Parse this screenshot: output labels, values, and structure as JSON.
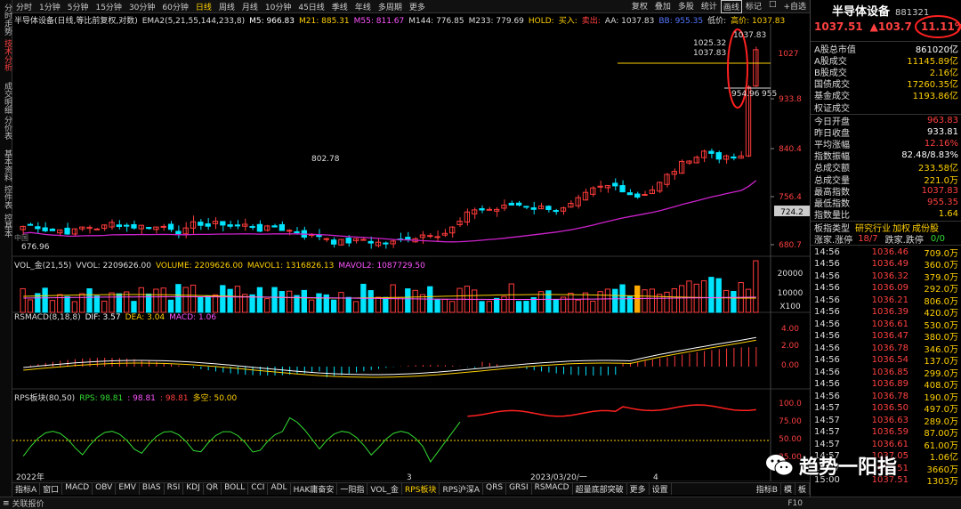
{
  "left_tabs": [
    {
      "label": "分时走势",
      "active": false
    },
    {
      "label": "技术分析",
      "active": true
    },
    {
      "label": "成交明细",
      "active": false
    },
    {
      "label": "分价表",
      "active": false
    },
    {
      "label": "基本资料",
      "active": false
    },
    {
      "label": "控件表",
      "active": false
    },
    {
      "label": "控基本",
      "active": false
    }
  ],
  "toolbar": {
    "periods": [
      {
        "label": "分时",
        "active": false
      },
      {
        "label": "1分钟",
        "active": false
      },
      {
        "label": "5分钟",
        "active": false
      },
      {
        "label": "15分钟",
        "active": false
      },
      {
        "label": "30分钟",
        "active": false
      },
      {
        "label": "60分钟",
        "active": false
      },
      {
        "label": "日线",
        "active": true
      },
      {
        "label": "周线",
        "active": false
      },
      {
        "label": "月线",
        "active": false
      },
      {
        "label": "10分钟",
        "active": false
      },
      {
        "label": "45日线",
        "active": false
      },
      {
        "label": "季线",
        "active": false
      },
      {
        "label": "年线",
        "active": false
      },
      {
        "label": "多周期",
        "active": false
      },
      {
        "label": "更多",
        "active": false
      }
    ],
    "tools": [
      {
        "label": "复权",
        "boxed": false
      },
      {
        "label": "叠加",
        "boxed": false
      },
      {
        "label": "多股",
        "boxed": false
      },
      {
        "label": "统计",
        "boxed": false
      },
      {
        "label": "画线",
        "boxed": true
      },
      {
        "label": "标记",
        "boxed": false
      },
      {
        "label": "□",
        "boxed": false
      },
      {
        "label": "+自选",
        "boxed": false
      }
    ]
  },
  "main_legend": [
    {
      "text": "半导体设备(日线,等比前复权,对数)",
      "color": "#dddddd"
    },
    {
      "text": "EMA2(5,21,55,144,233,8)",
      "color": "#dddddd"
    },
    {
      "text": "M5: 966.83",
      "color": "#ffffff"
    },
    {
      "text": "M21: 885.31",
      "color": "#ffd000"
    },
    {
      "text": "M55: 811.67",
      "color": "#ff55ff"
    },
    {
      "text": "M144: 776.85",
      "color": "#dddddd"
    },
    {
      "text": "M233: 779.69",
      "color": "#dddddd"
    },
    {
      "text": "HOLD:",
      "color": "#ffd000"
    },
    {
      "text": "买入:",
      "color": "#ffd000"
    },
    {
      "text": "卖出:",
      "color": "#ff4040"
    },
    {
      "text": "AA: 1037.83",
      "color": "#dddddd"
    },
    {
      "text": "BB: 955.35",
      "color": "#5577ff"
    },
    {
      "text": "低价:",
      "color": "#dddddd"
    },
    {
      "text": "高价: 1037.83",
      "color": "#ffd000"
    }
  ],
  "main_annotations": {
    "high_top": "1037.83",
    "high_a": "1025.32",
    "high_b": "1037.83",
    "low_recent": "954.96",
    "low_recent_b": "955",
    "mid_peak": "802.78",
    "low_left": "676.96",
    "last_price_tag": "724.2",
    "left_tag": "中国",
    "right_tag": "1027"
  },
  "price_axis": [
    "933.8",
    "840.4",
    "756.4",
    "680.7"
  ],
  "date_axis": [
    "2022年",
    "3",
    "2023/03/20/一",
    "4"
  ],
  "volume_legend": [
    {
      "text": "VOL_金(21,55)",
      "color": "#dddddd"
    },
    {
      "text": "VVOL: 2209626.00",
      "color": "#dddddd"
    },
    {
      "text": "VOLUME: 2209626.00",
      "color": "#ffd000"
    },
    {
      "text": "MAVOL1: 1316826.13",
      "color": "#ffd000"
    },
    {
      "text": "MAVOL2: 1087729.50",
      "color": "#ff55ff"
    }
  ],
  "volume_axis": [
    "20000",
    "10000",
    "X100"
  ],
  "macd_legend": [
    {
      "text": "RSMACD(8,18,8)",
      "color": "#dddddd"
    },
    {
      "text": "DIF: 3.57",
      "color": "#ffffff"
    },
    {
      "text": "DEA: 3.04",
      "color": "#ffd000"
    },
    {
      "text": "MACD: 1.06",
      "color": "#ff55ff"
    }
  ],
  "macd_axis": [
    "4.00",
    "2.00",
    "0.00"
  ],
  "rps_legend": [
    {
      "text": "RPS板块(80,50)",
      "color": "#dddddd"
    },
    {
      "text": "RPS: 98.81",
      "color": "#33dd33"
    },
    {
      "text": ": 98.81",
      "color": "#ff55ff"
    },
    {
      "text": ": 98.81",
      "color": "#ff4040"
    },
    {
      "text": "多空: 50.00",
      "color": "#ffd000"
    }
  ],
  "rps_axis": [
    "100.0",
    "75.00",
    "50.00",
    "25.00"
  ],
  "bottom_tabs": [
    {
      "label": "指标A",
      "active": false
    },
    {
      "label": "窗口",
      "active": false
    },
    {
      "label": "MACD",
      "active": false
    },
    {
      "label": "OBV",
      "active": false
    },
    {
      "label": "EMV",
      "active": false
    },
    {
      "label": "BIAS",
      "active": false
    },
    {
      "label": "RSI",
      "active": false
    },
    {
      "label": "KDJ",
      "active": false
    },
    {
      "label": "QR",
      "active": false
    },
    {
      "label": "BOLL",
      "active": false
    },
    {
      "label": "CCI",
      "active": false
    },
    {
      "label": "ADL",
      "active": false
    },
    {
      "label": "HAK庸奋安",
      "active": false
    },
    {
      "label": "一阳指",
      "active": false
    },
    {
      "label": "VOL_金",
      "active": false
    },
    {
      "label": "RPS板块",
      "active": true
    },
    {
      "label": "RPS沪深A",
      "active": false
    },
    {
      "label": "QRS",
      "active": false
    },
    {
      "label": "GRSI",
      "active": false
    },
    {
      "label": "RSMACD",
      "active": false
    },
    {
      "label": "超量底部突破",
      "active": false
    },
    {
      "label": "更多",
      "active": false
    },
    {
      "label": "设置",
      "active": false
    }
  ],
  "bottom_right_tabs": [
    "指标B",
    "模",
    "板"
  ],
  "status": {
    "left": "关联报价",
    "right": "F10"
  },
  "panel": {
    "name": "半导体设备",
    "code": "881321",
    "price": "1037.51",
    "change": "▲103.7",
    "pct": "11.11%",
    "rows1": [
      {
        "label": "A股总市值",
        "value": "861020亿",
        "color": "#ffffff"
      },
      {
        "label": "A股成交",
        "value": "11145.89亿",
        "color": "#ffd000"
      },
      {
        "label": "B股成交",
        "value": "2.16亿",
        "color": "#ffd000"
      },
      {
        "label": "国债成交",
        "value": "17260.35亿",
        "color": "#ffd000"
      },
      {
        "label": "基金成交",
        "value": "1193.86亿",
        "color": "#ffd000"
      },
      {
        "label": "权证成交",
        "value": "",
        "color": "#ffd000"
      }
    ],
    "rows2": [
      {
        "label": "今日开盘",
        "value": "963.83",
        "color": "#ff4040"
      },
      {
        "label": "昨日收盘",
        "value": "933.81",
        "color": "#ffffff"
      },
      {
        "label": "平均涨幅",
        "value": "12.16%",
        "color": "#ff4040"
      },
      {
        "label": "指数振幅",
        "value": "82.48/8.83%",
        "color": "#ffffff"
      },
      {
        "label": "总成交额",
        "value": "233.58亿",
        "color": "#ffd000"
      },
      {
        "label": "总成交量",
        "value": "221.0万",
        "color": "#ffd000"
      },
      {
        "label": "最高指数",
        "value": "1037.83",
        "color": "#ff4040"
      },
      {
        "label": "最低指数",
        "value": "955.35",
        "color": "#ff4040"
      },
      {
        "label": "指数量比",
        "value": "1.64",
        "color": "#ffd000"
      }
    ],
    "industry_row": {
      "label": "板指类型",
      "items": [
        "研究行业",
        "加权",
        "成份股"
      ]
    },
    "updown_row": {
      "label": "涨家.涨停",
      "value": "18/7",
      "label2": "跌家.跌停",
      "value2": "0/0"
    },
    "ticks": [
      {
        "time": "14:56",
        "price": "1036.46",
        "vol": "709.0万"
      },
      {
        "time": "14:56",
        "price": "1036.49",
        "vol": "360.0万"
      },
      {
        "time": "14:56",
        "price": "1036.32",
        "vol": "379.0万"
      },
      {
        "time": "14:56",
        "price": "1036.09",
        "vol": "292.0万"
      },
      {
        "time": "14:56",
        "price": "1036.21",
        "vol": "806.0万"
      },
      {
        "time": "14:56",
        "price": "1036.39",
        "vol": "420.0万"
      },
      {
        "time": "14:56",
        "price": "1036.61",
        "vol": "530.0万"
      },
      {
        "time": "14:56",
        "price": "1036.47",
        "vol": "380.0万"
      },
      {
        "time": "14:56",
        "price": "1036.78",
        "vol": "346.0万"
      },
      {
        "time": "14:56",
        "price": "1036.54",
        "vol": "137.0万"
      },
      {
        "time": "14:56",
        "price": "1036.85",
        "vol": "299.0万"
      },
      {
        "time": "14:56",
        "price": "1036.89",
        "vol": "408.0万"
      },
      {
        "time": "14:56",
        "price": "1036.78",
        "vol": "190.0万"
      },
      {
        "time": "14:57",
        "price": "1036.50",
        "vol": "497.0万"
      },
      {
        "time": "14:57",
        "price": "1036.63",
        "vol": "289.0万"
      },
      {
        "time": "14:57",
        "price": "1036.59",
        "vol": "87.00万"
      },
      {
        "time": "14:57",
        "price": "1036.61",
        "vol": "61.00万"
      },
      {
        "time": "14:57",
        "price": "1037.05",
        "vol": "1.06亿"
      },
      {
        "time": "14:57",
        "price": "1037.51",
        "vol": "3660万"
      },
      {
        "time": "15:00",
        "price": "1037.51",
        "vol": "1303万"
      }
    ]
  },
  "watermark": "趋势一阳指",
  "colors": {
    "up": "#ff3b3b",
    "down": "#00e5ff",
    "ma_purple": "#cc22cc",
    "highlight_circle": "#ff2020"
  }
}
